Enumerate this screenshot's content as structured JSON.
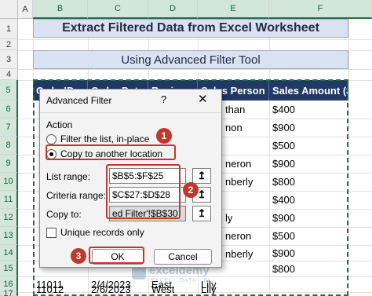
{
  "columns": [
    "A",
    "B",
    "C",
    "D",
    "E",
    "F"
  ],
  "rows": [
    "1",
    "2",
    "3",
    "4",
    "5",
    "6",
    "7",
    "8",
    "9",
    "10",
    "11",
    "12",
    "13",
    "14",
    "15",
    "16",
    "17"
  ],
  "title": "Extract Filtered Data from Excel Worksheet",
  "subtitle": "Using Advanced Filter Tool",
  "table": {
    "headers": [
      "Order ID",
      "Order Date",
      "Region",
      "Sales Person",
      "Sales Amount ($)"
    ],
    "header_visible": [
      "OrderID",
      "Order Date",
      "Region",
      "Sales Person",
      "Sales Amount ($)"
    ],
    "amounts": [
      "$400",
      "$900",
      "$500",
      "$900",
      "$800",
      "$400",
      "$900",
      "$500",
      "$900",
      "$800"
    ],
    "person_fragments": [
      "than",
      "non",
      "",
      "neron",
      "nberly",
      "ly",
      "neron",
      "nberly",
      "",
      ""
    ],
    "bottom_rows": [
      {
        "id": "11011",
        "date": "2/4/2023",
        "region": "East",
        "person": "Lily",
        "amount": ""
      },
      {
        "id": "11012",
        "date": "2/6/2023",
        "region": "West",
        "person": "Lily",
        "amount": ""
      }
    ]
  },
  "dialog": {
    "title": "Advanced Filter",
    "help": "?",
    "close": "✕",
    "action_label": "Action",
    "radio_inplace": "Filter the list, in-place",
    "radio_copy": "Copy to another location",
    "list_range_label": "List range:",
    "list_range_value": "$B$5:$F$25",
    "criteria_range_label": "Criteria range:",
    "criteria_range_value": "$C$27:$D$28",
    "copy_to_label": "Copy to:",
    "copy_to_value": "ed Filter'!$B$30",
    "unique_label": "Unique records only",
    "ok": "OK",
    "cancel": "Cancel",
    "ref_icon": "↥"
  },
  "badges": [
    "1",
    "2",
    "3"
  ],
  "watermark": {
    "name": "exceldemy",
    "sub": "EXCEL · DATA · BI"
  },
  "colors": {
    "header_fill": "#203864",
    "title_fill": "#d9e1f2",
    "annotation_red": "#c0392b",
    "selection_green": "#1e7145"
  }
}
